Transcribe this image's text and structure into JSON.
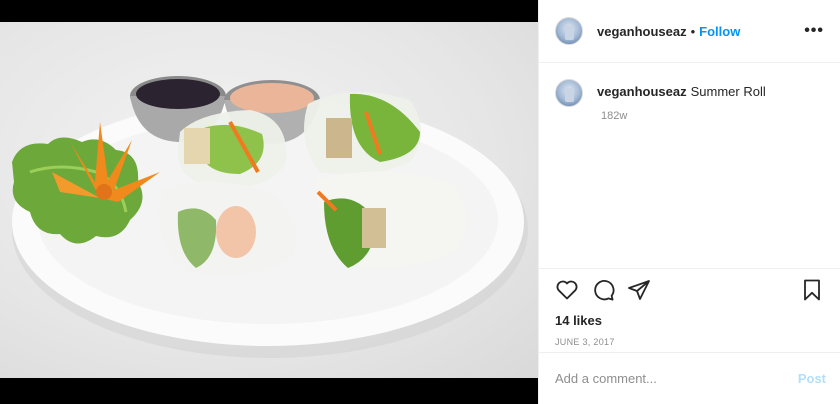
{
  "post": {
    "username": "veganhouseaz",
    "separator": "•",
    "follow_label": "Follow",
    "more_label": "•••",
    "caption_text": "Summer Roll",
    "age": "182w",
    "likes": "14 likes",
    "date": "JUNE 3, 2017",
    "comment_placeholder": "Add a comment...",
    "post_label": "Post"
  },
  "icons": {
    "like": "heart-icon",
    "comment": "comment-bubble-icon",
    "share": "paper-plane-icon",
    "save": "bookmark-icon",
    "more": "more-options-icon"
  },
  "colors": {
    "accent": "#0095f6",
    "post_disabled": "#b2dffc",
    "muted": "#8e8e8e"
  }
}
